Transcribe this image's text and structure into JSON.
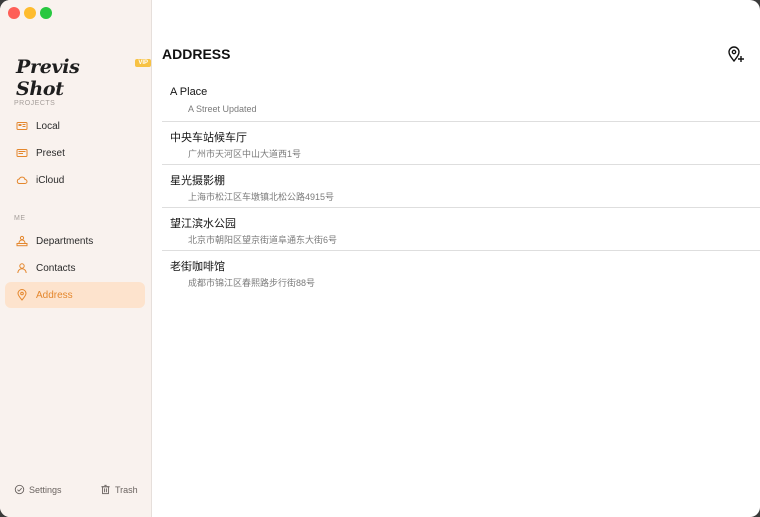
{
  "app": {
    "name": "Previs Shot",
    "badge": "VIP"
  },
  "sidebar": {
    "projects_title": "PROJECTS",
    "projects": [
      {
        "label": "Local",
        "icon": "local-icon"
      },
      {
        "label": "Preset",
        "icon": "preset-icon"
      },
      {
        "label": "iCloud",
        "icon": "cloud-icon"
      }
    ],
    "me_title": "ME",
    "me": [
      {
        "label": "Departments",
        "icon": "departments-icon"
      },
      {
        "label": "Contacts",
        "icon": "contacts-icon"
      },
      {
        "label": "Address",
        "icon": "location-pin-icon",
        "active": true
      }
    ],
    "settings_label": "Settings",
    "trash_label": "Trash"
  },
  "main": {
    "title": "ADDRESS",
    "addresses": [
      {
        "name": "A Place",
        "address": "A Street Updated"
      },
      {
        "name": "中央车站候车厅",
        "address": "广州市天河区中山大道西1号"
      },
      {
        "name": "星光摄影棚",
        "address": "上海市松江区车墩镇北松公路4915号"
      },
      {
        "name": "望江滨水公园",
        "address": "北京市朝阳区望京街道阜通东大街6号"
      },
      {
        "name": "老街咖啡馆",
        "address": "成都市锦江区春熙路步行街88号"
      }
    ]
  },
  "colors": {
    "accent": "#e4872d",
    "active_bg": "#fde3cd",
    "sidebar_bg": "#f9f2ee"
  }
}
